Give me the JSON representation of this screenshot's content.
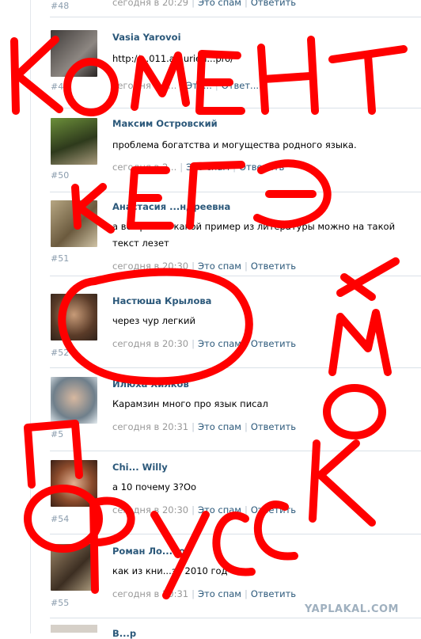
{
  "top_partial": {
    "number": "#48",
    "time": "сегодня в 20:29",
    "spam": "Это спам",
    "reply": "Ответить"
  },
  "comments": [
    {
      "author": "Vasia Yarovoi",
      "text": "http://...011.a...urien...pro/",
      "number": "#4",
      "time": "сегодня в 2...",
      "spam": "Это...",
      "reply": "Ответ...",
      "avatar_color": "#5e5a57"
    },
    {
      "author": "Максим Островский",
      "text": "проблема богатства и могущества родного языка.",
      "number": "#50",
      "time": "сегодня в 2...",
      "spam": "Это спам",
      "reply": "Ответить",
      "avatar_color": "#4a5a2c"
    },
    {
      "author": "Анастасия ...ндреевна",
      "text": "а все равно. какой пример из литературы можно на такой текст лезет",
      "number": "#51",
      "time": "сегодня в 20:30",
      "spam": "Это спам",
      "reply": "Ответить",
      "avatar_color": "#8c7a5c"
    },
    {
      "author": "Настюша Крылова",
      "text": "через чур легкий",
      "number": "#52",
      "time": "сегодня в 20:30",
      "spam": "Это спам",
      "reply": "Ответить",
      "avatar_color": "#6c4f3c"
    },
    {
      "author": "Илюха Хилков",
      "text": "Карамзин много про язык писал",
      "number": "#5",
      "time": "сегодня в 20:31",
      "spam": "Это спам",
      "reply": "Ответить",
      "avatar_color": "#7e8e9a"
    },
    {
      "author": "Chi... Willy",
      "text": "а 10 почему 3?Оо",
      "number": "#54",
      "time": "сегодня в 20:30",
      "spam": "Это спам",
      "reply": "Ответить",
      "avatar_color": "#9b6446"
    },
    {
      "author": "Роман Ло...нов",
      "text": "как из кни...за 2010 год",
      "number": "#55",
      "time": "сегодня в 20:31",
      "spam": "Это спам",
      "reply": "Ответить",
      "avatar_color": "#5b4a36"
    }
  ],
  "bottom_partial": {
    "author": "В...р"
  },
  "overlay": {
    "word_1": "КОМЕНТ",
    "word_2": "К ЕГЭ",
    "word_3": "ПО",
    "word_4": "РУССКОМУ",
    "color": "#ff0000"
  },
  "watermark": "YAPLAKAL.COM"
}
